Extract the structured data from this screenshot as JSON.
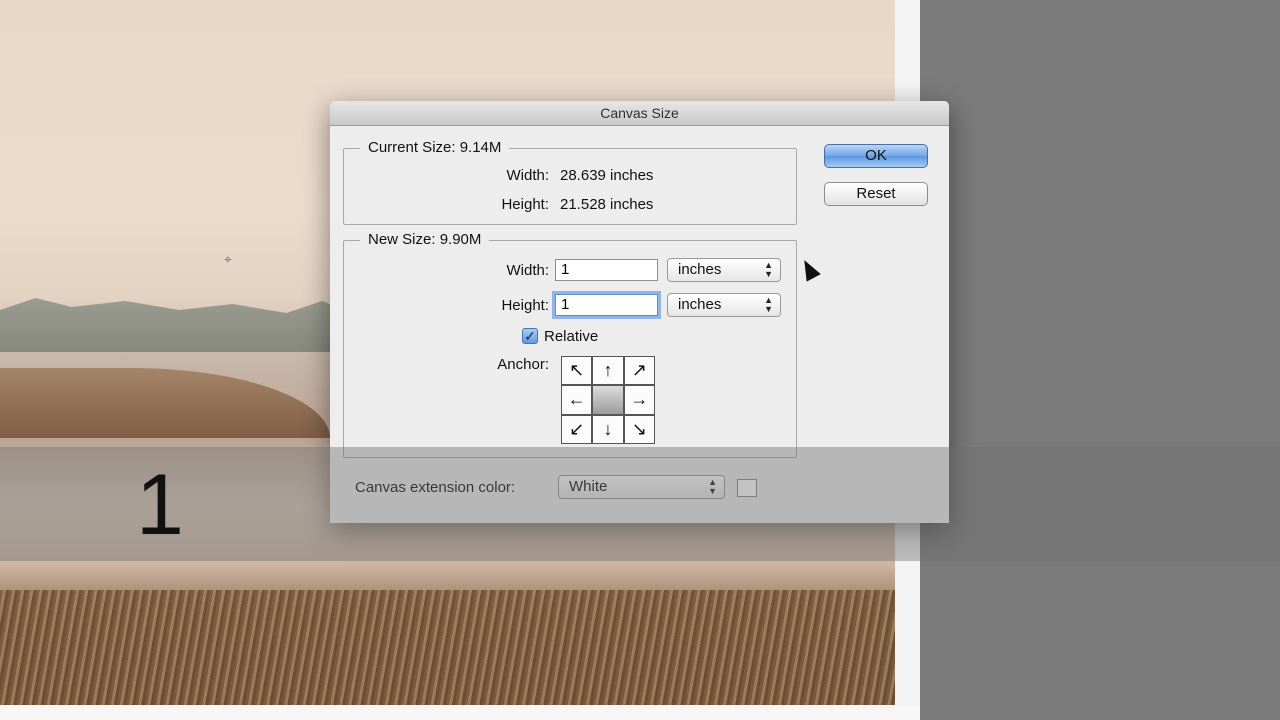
{
  "dialog": {
    "title": "Canvas Size",
    "current_size": {
      "legend": "Current Size: 9.14M",
      "width_label": "Width:",
      "width_value": "28.639 inches",
      "height_label": "Height:",
      "height_value": "21.528 inches"
    },
    "new_size": {
      "legend": "New Size: 9.90M",
      "width_label": "Width:",
      "width_value": "1",
      "width_unit": "inches",
      "height_label": "Height:",
      "height_value": "1",
      "height_unit": "inches",
      "relative_label": "Relative",
      "relative_checked": true,
      "anchor_label": "Anchor:",
      "anchor_arrows": [
        "↖",
        "↑",
        "↗",
        "←",
        "",
        "→",
        "↙",
        "↓",
        "↘"
      ]
    },
    "extension": {
      "label": "Canvas extension color:",
      "value": "White"
    },
    "buttons": {
      "ok": "OK",
      "reset": "Reset"
    }
  },
  "overlay": {
    "number": "1"
  },
  "colors": {
    "default_button": "#5b97e0",
    "focus_ring": "#8fb6e6"
  }
}
